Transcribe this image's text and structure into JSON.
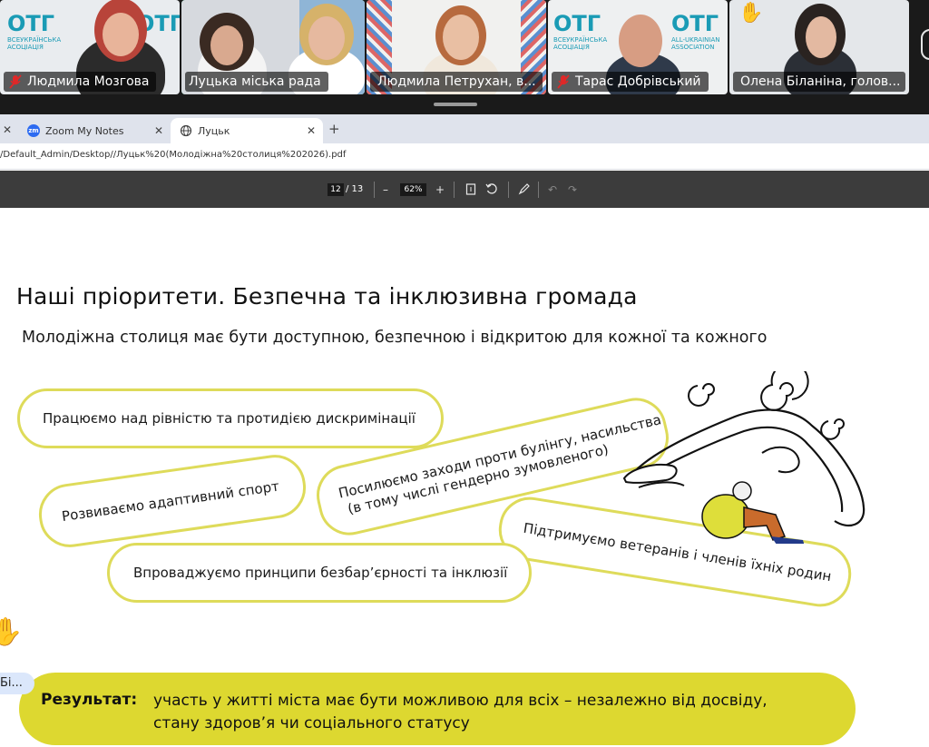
{
  "participants": [
    {
      "name": "Людмила Мозгова",
      "muted": true
    },
    {
      "name": "Луцька міська рада",
      "muted": false,
      "active_speaker": true
    },
    {
      "name": "Людмила Петрухан, в...",
      "muted": true
    },
    {
      "name": "Тарас Добрівський",
      "muted": true
    },
    {
      "name": "Олена Біланіна, голов...",
      "muted": true
    }
  ],
  "logos": {
    "otg_mark": "ОТГ",
    "otg_ua_line1": "ВСЕУКРАЇНСЬКА",
    "otg_ua_line2": "АСОЦІАЦІЯ",
    "otg_en_line1": "ALL-UKRAINIAN",
    "otg_en_line2": "ASSOCIATION",
    "otg_ua_short": "ВСЕУКРАЇНСЬКА",
    "otg_en_short": "ALL-UKRAINIAN"
  },
  "raised_hand_icon": "waving-hand-icon",
  "browser": {
    "tabs": [
      {
        "label": "Zoom My Notes",
        "icon": "zoom-icon"
      },
      {
        "label": "Луцьк",
        "icon": "globe-icon",
        "active": true
      }
    ],
    "new_tab_label": "+",
    "url": "/Default_Admin/Desktop//Луцьк%20(Молодіжна%20столиця%202026).pdf"
  },
  "pdf_toolbar": {
    "current_page": "12",
    "total_pages": "/ 13",
    "zoom_out": "–",
    "zoom_level": "62%",
    "zoom_in": "+"
  },
  "slide": {
    "title": "Наші пріоритети. Безпечна та інклюзивна громада",
    "subtitle": "Молодіжна столиця має бути доступною, безпечною і відкритою для кожної та кожного",
    "pills": [
      {
        "text": "Працюємо над рівністю та протидією дискримінації"
      },
      {
        "text": "Розвиваємо адаптивний спорт"
      },
      {
        "line1": "Посилюємо заходи проти булінгу, насильства",
        "line2": "(в тому числі гендерно зумовленого)"
      },
      {
        "text": "Підтримуємо ветеранів і членів їхніх родин"
      },
      {
        "text": "Впроваджуємо принципи безбар’єрності та інклюзії"
      }
    ],
    "result_label": "Результат:",
    "result_line1": "участь у житті міста має бути можливою для всіх – незалежно від досвіду,",
    "result_line2": "стану здоров’я чи соціального статусу"
  },
  "chat_bubble": "Бі..."
}
